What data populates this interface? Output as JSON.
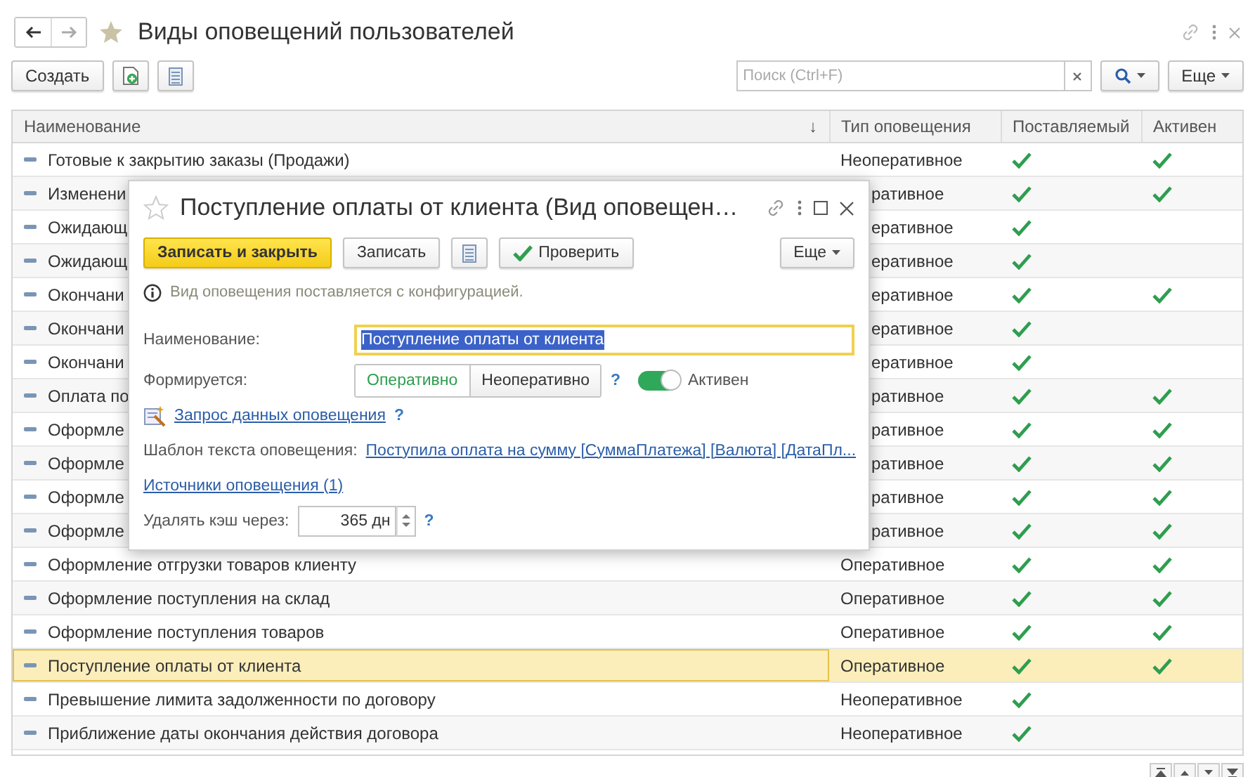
{
  "window": {
    "title": "Виды оповещений пользователей"
  },
  "toolbar": {
    "create_button": "Создать",
    "search": {
      "placeholder": "Поиск (Ctrl+F)"
    },
    "more_button": "Еще"
  },
  "table": {
    "columns": [
      {
        "label": "Наименование",
        "sort_mark": "↓"
      },
      {
        "label": "Тип оповещения"
      },
      {
        "label": "Поставляемый"
      },
      {
        "label": "Активен"
      }
    ],
    "rows": [
      {
        "name": "Готовые к закрытию заказы (Продажи)",
        "type": "Неоперативное",
        "supplied": true,
        "active": true,
        "selected": false,
        "covered": false
      },
      {
        "name": "Изменени",
        "type": "ративное",
        "supplied": true,
        "active": true,
        "selected": false,
        "covered": true
      },
      {
        "name": "Ожидающ",
        "type": "еративное",
        "supplied": true,
        "active": false,
        "selected": false,
        "covered": true
      },
      {
        "name": "Ожидающ",
        "type": "еративное",
        "supplied": true,
        "active": false,
        "selected": false,
        "covered": true
      },
      {
        "name": "Окончани",
        "type": "еративное",
        "supplied": true,
        "active": true,
        "selected": false,
        "covered": true
      },
      {
        "name": "Окончани",
        "type": "еративное",
        "supplied": true,
        "active": false,
        "selected": false,
        "covered": true
      },
      {
        "name": "Окончани",
        "type": "еративное",
        "supplied": true,
        "active": false,
        "selected": false,
        "covered": true
      },
      {
        "name": "Оплата по",
        "type": "ративное",
        "supplied": true,
        "active": true,
        "selected": false,
        "covered": true
      },
      {
        "name": "Оформле",
        "type": "ративное",
        "supplied": true,
        "active": true,
        "selected": false,
        "covered": true
      },
      {
        "name": "Оформле",
        "type": "ративное",
        "supplied": true,
        "active": true,
        "selected": false,
        "covered": true
      },
      {
        "name": "Оформле",
        "type": "ративное",
        "supplied": true,
        "active": true,
        "selected": false,
        "covered": true
      },
      {
        "name": "Оформле",
        "type": "ративное",
        "supplied": true,
        "active": true,
        "selected": false,
        "covered": true
      },
      {
        "name": "Оформление отгрузки товаров клиенту",
        "type": "Оперативное",
        "supplied": true,
        "active": true,
        "selected": false,
        "covered": false
      },
      {
        "name": "Оформление поступления на склад",
        "type": "Оперативное",
        "supplied": true,
        "active": true,
        "selected": false,
        "covered": false
      },
      {
        "name": "Оформление поступления товаров",
        "type": "Оперативное",
        "supplied": true,
        "active": true,
        "selected": false,
        "covered": false
      },
      {
        "name": "Поступление оплаты от клиента",
        "type": "Оперативное",
        "supplied": true,
        "active": true,
        "selected": true,
        "covered": false
      },
      {
        "name": "Превышение лимита задолженности по договору",
        "type": "Неоперативное",
        "supplied": true,
        "active": false,
        "selected": false,
        "covered": false
      },
      {
        "name": "Приближение даты окончания действия договора",
        "type": "Неоперативное",
        "supplied": true,
        "active": false,
        "selected": false,
        "covered": false
      }
    ]
  },
  "dialog": {
    "title": "Поступление оплаты от клиента (Вид оповещен…",
    "save_close_button": "Записать и закрыть",
    "save_button": "Записать",
    "check_button": "Проверить",
    "more_button": "Еще",
    "info": "Вид оповещения поставляется с конфигурацией.",
    "name_label": "Наименование:",
    "name_value": "Поступление оплаты от клиента",
    "mode_label": "Формируется:",
    "mode_options": [
      {
        "label": "Оперативно",
        "selected": true
      },
      {
        "label": "Неоперативно",
        "selected": false
      }
    ],
    "help_mark": "?",
    "active_toggle": {
      "label": "Активен",
      "on": true
    },
    "query_link": "Запрос данных оповещения",
    "query_help": "?",
    "template_label": "Шаблон текста оповещения:",
    "template_link": "Поступила оплата на сумму [СуммаПлатежа] [Валюта] [ДатаПл...",
    "sources_link": "Источники оповещения (1)",
    "cache_label": "Удалять кэш через:",
    "cache_value": "365 дн",
    "cache_help": "?"
  }
}
